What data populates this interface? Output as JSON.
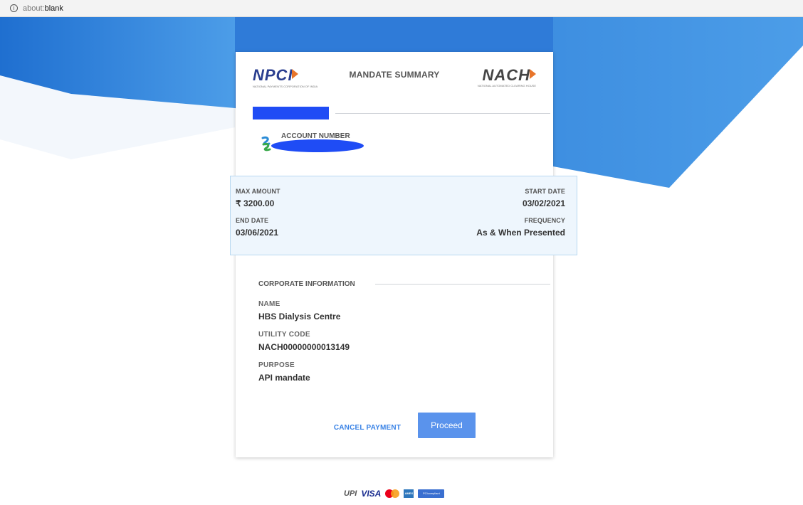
{
  "browser": {
    "url_scheme": "about:",
    "url_host": "blank"
  },
  "header": {
    "npci_logo_text": "NPCI",
    "npci_logo_subtext": "NATIONAL PAYMENTS CORPORATION OF INDIA",
    "title": "MANDATE SUMMARY",
    "nach_logo_text": "NACH",
    "nach_logo_subtext": "NATIONAL AUTOMATED CLEARING HOUSE"
  },
  "account": {
    "label": "ACCOUNT NUMBER"
  },
  "mandate": {
    "max_amount_label": "MAX AMOUNT",
    "max_amount_value": "₹ 3200.00",
    "start_date_label": "START DATE",
    "start_date_value": "03/02/2021",
    "end_date_label": "END DATE",
    "end_date_value": "03/06/2021",
    "frequency_label": "FREQUENCY",
    "frequency_value": "As & When Presented"
  },
  "corporate": {
    "heading": "CORPORATE INFORMATION",
    "name_label": "NAME",
    "name_value": "HBS Dialysis Centre",
    "utility_code_label": "UTILITY CODE",
    "utility_code_value": "NACH00000000013149",
    "purpose_label": "PURPOSE",
    "purpose_value": "API mandate"
  },
  "actions": {
    "cancel_label": "CANCEL PAYMENT",
    "proceed_label": "Proceed"
  },
  "footer": {
    "upi_text": "UPI",
    "visa_text": "VISA",
    "amex_text": "AMEX",
    "pci_text": "PCIcompliant"
  },
  "colors": {
    "background_gradient_start": "#1f6fd0",
    "background_gradient_end": "#4c9de8",
    "summary_box_bg": "#eef6fd",
    "summary_box_border": "#b8d8f1",
    "proceed_button": "#5a93ec",
    "cancel_link": "#3a83e6",
    "redaction": "#1f4cf5"
  },
  "icons": {
    "info": "info-circle-icon",
    "bank": "standard-chartered-bank-icon"
  }
}
